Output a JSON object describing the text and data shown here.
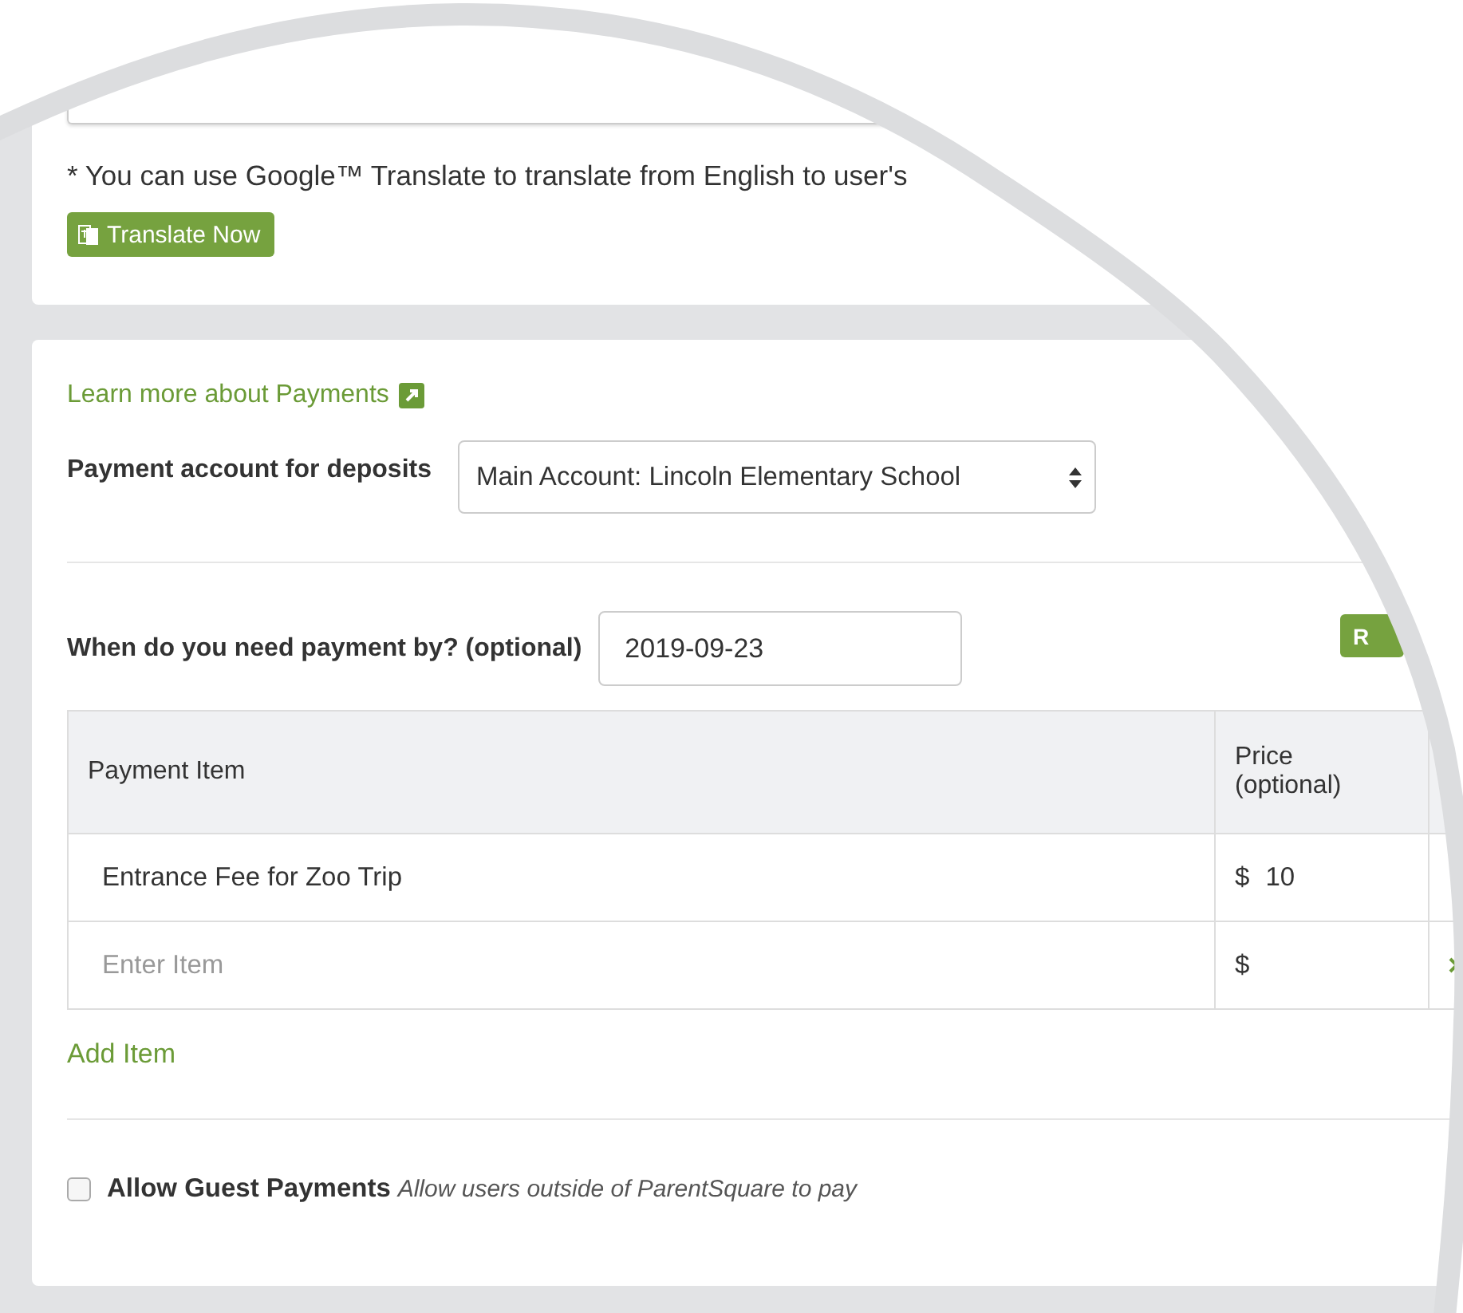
{
  "translate_note": "* You can use Google™ Translate to translate from English to user's",
  "translate_button": "Translate Now",
  "learn_more_link": "Learn more about Payments",
  "payment_account": {
    "label": "Payment account for deposits",
    "value": "Main Account: Lincoln Elementary School"
  },
  "due_date": {
    "label": "When do you need payment by? (optional)",
    "value": "2019-09-23"
  },
  "side_button": "R",
  "table": {
    "columns": [
      "Payment Item",
      "Price (optional)"
    ],
    "rows": [
      {
        "item": "Entrance Fee for Zoo Trip",
        "currency": "$",
        "price": "10"
      },
      {
        "placeholder": "Enter Item",
        "currency": "$"
      }
    ]
  },
  "add_item_link": "Add Item",
  "guest_payments": {
    "label": "Allow Guest Payments",
    "hint": "Allow users outside of ParentSquare to pay",
    "checked": false
  }
}
